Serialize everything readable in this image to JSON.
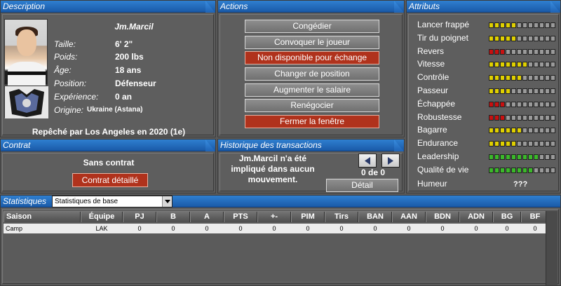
{
  "description": {
    "header": "Description",
    "player_name": "Jm.Marcil",
    "fields": [
      {
        "label": "Taille:",
        "value": "6' 2\""
      },
      {
        "label": "Poids:",
        "value": "200 lbs"
      },
      {
        "label": "Âge:",
        "value": "18 ans"
      },
      {
        "label": "Position:",
        "value": "Défenseur"
      },
      {
        "label": "Expérience:",
        "value": "0 an"
      },
      {
        "label": "Origine:",
        "value": "Ukraine (Astana)"
      }
    ],
    "drafted": "Repêché par Los Angeles en 2020 (1e)"
  },
  "actions": {
    "header": "Actions",
    "buttons": [
      {
        "label": "Congédier",
        "style": "grey"
      },
      {
        "label": "Convoquer le joueur",
        "style": "grey"
      },
      {
        "label": "Non disponible pour échange",
        "style": "red"
      },
      {
        "label": "Changer de position",
        "style": "grey"
      },
      {
        "label": "Augmenter le salaire",
        "style": "grey"
      },
      {
        "label": "Renégocier",
        "style": "grey"
      },
      {
        "label": "Fermer la fenêtre",
        "style": "red"
      }
    ]
  },
  "attributes": {
    "header": "Attributs",
    "items": [
      {
        "label": "Lancer frappé",
        "level": 5,
        "color": "y"
      },
      {
        "label": "Tir du poignet",
        "level": 5,
        "color": "y"
      },
      {
        "label": "Revers",
        "level": 3,
        "color": "r"
      },
      {
        "label": "Vitesse",
        "level": 7,
        "color": "y"
      },
      {
        "label": "Contrôle",
        "level": 6,
        "color": "y"
      },
      {
        "label": "Passeur",
        "level": 4,
        "color": "y"
      },
      {
        "label": "Échappée",
        "level": 3,
        "color": "r"
      },
      {
        "label": "Robustesse",
        "level": 3,
        "color": "r"
      },
      {
        "label": "Bagarre",
        "level": 6,
        "color": "y"
      },
      {
        "label": "Endurance",
        "level": 5,
        "color": "y"
      },
      {
        "label": "Leadership",
        "level": 9,
        "color": "g"
      },
      {
        "label": "Qualité de vie",
        "level": 8,
        "color": "g"
      }
    ],
    "mood_label": "Humeur",
    "mood_value": "???",
    "bar_count": 12
  },
  "contract": {
    "header": "Contrat",
    "status": "Sans contrat",
    "detail_button": "Contrat détaillé"
  },
  "history": {
    "header": "Historique des transactions",
    "message": "Jm.Marcil n'a été impliqué dans aucun mouvement.",
    "count": "0 de 0",
    "detail_button": "Détail"
  },
  "stats": {
    "header": "Statistiques",
    "select_value": "Statistiques de base",
    "columns": [
      "Saison",
      "Équipe",
      "PJ",
      "B",
      "A",
      "PTS",
      "+-",
      "PIM",
      "Tirs",
      "BAN",
      "AAN",
      "BDN",
      "ADN",
      "BG",
      "BF"
    ],
    "rows": [
      [
        "Camp",
        "LAK",
        "0",
        "0",
        "0",
        "0",
        "0",
        "0",
        "0",
        "0",
        "0",
        "0",
        "0",
        "0",
        "0"
      ]
    ]
  },
  "colors": {
    "header_blue": "#1a5aa8",
    "button_red": "#b0321c",
    "panel_grey": "#5b5b5b"
  }
}
